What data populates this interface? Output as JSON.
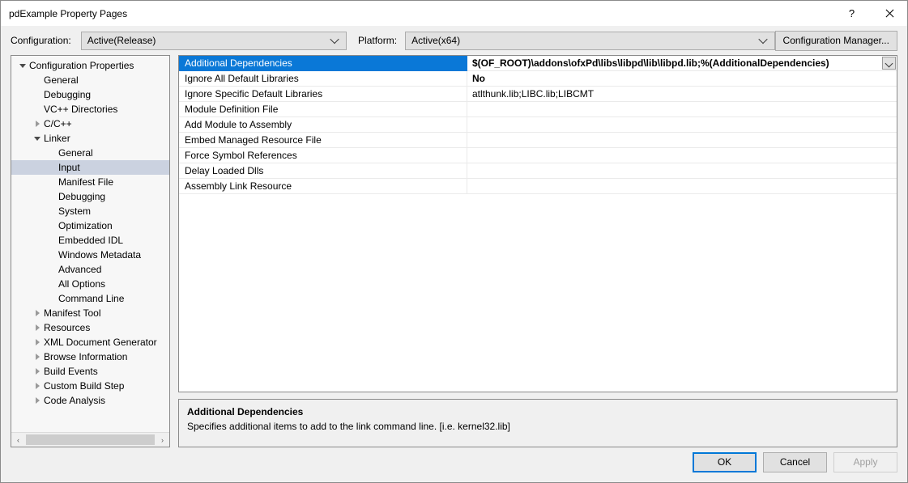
{
  "window": {
    "title": "pdExample Property Pages",
    "help_glyph": "?",
    "close_glyph": "✕"
  },
  "toolbar": {
    "configuration_label": "Configuration:",
    "configuration_value": "Active(Release)",
    "platform_label": "Platform:",
    "platform_value": "Active(x64)",
    "configuration_manager_label": "Configuration Manager..."
  },
  "tree": {
    "nodes": [
      {
        "label": "Configuration Properties",
        "indent": 0,
        "expander": "open",
        "selected": false
      },
      {
        "label": "General",
        "indent": 1,
        "expander": "none",
        "selected": false
      },
      {
        "label": "Debugging",
        "indent": 1,
        "expander": "none",
        "selected": false
      },
      {
        "label": "VC++ Directories",
        "indent": 1,
        "expander": "none",
        "selected": false
      },
      {
        "label": "C/C++",
        "indent": 1,
        "expander": "closed",
        "selected": false
      },
      {
        "label": "Linker",
        "indent": 1,
        "expander": "open",
        "selected": false
      },
      {
        "label": "General",
        "indent": 2,
        "expander": "none",
        "selected": false
      },
      {
        "label": "Input",
        "indent": 2,
        "expander": "none",
        "selected": true
      },
      {
        "label": "Manifest File",
        "indent": 2,
        "expander": "none",
        "selected": false
      },
      {
        "label": "Debugging",
        "indent": 2,
        "expander": "none",
        "selected": false
      },
      {
        "label": "System",
        "indent": 2,
        "expander": "none",
        "selected": false
      },
      {
        "label": "Optimization",
        "indent": 2,
        "expander": "none",
        "selected": false
      },
      {
        "label": "Embedded IDL",
        "indent": 2,
        "expander": "none",
        "selected": false
      },
      {
        "label": "Windows Metadata",
        "indent": 2,
        "expander": "none",
        "selected": false
      },
      {
        "label": "Advanced",
        "indent": 2,
        "expander": "none",
        "selected": false
      },
      {
        "label": "All Options",
        "indent": 2,
        "expander": "none",
        "selected": false
      },
      {
        "label": "Command Line",
        "indent": 2,
        "expander": "none",
        "selected": false
      },
      {
        "label": "Manifest Tool",
        "indent": 1,
        "expander": "closed",
        "selected": false
      },
      {
        "label": "Resources",
        "indent": 1,
        "expander": "closed",
        "selected": false
      },
      {
        "label": "XML Document Generator",
        "indent": 1,
        "expander": "closed",
        "selected": false
      },
      {
        "label": "Browse Information",
        "indent": 1,
        "expander": "closed",
        "selected": false
      },
      {
        "label": "Build Events",
        "indent": 1,
        "expander": "closed",
        "selected": false
      },
      {
        "label": "Custom Build Step",
        "indent": 1,
        "expander": "closed",
        "selected": false
      },
      {
        "label": "Code Analysis",
        "indent": 1,
        "expander": "closed",
        "selected": false
      }
    ],
    "scrollbar": {
      "left_arrow": "‹",
      "right_arrow": "›"
    }
  },
  "grid": {
    "rows": [
      {
        "name": "Additional Dependencies",
        "value": "$(OF_ROOT)\\addons\\ofxPd\\libs\\libpd\\lib\\libpd.lib;%(AdditionalDependencies)",
        "selected": true,
        "bold": true,
        "dropdown": true
      },
      {
        "name": "Ignore All Default Libraries",
        "value": "No",
        "selected": false,
        "bold": true,
        "dropdown": false
      },
      {
        "name": "Ignore Specific Default Libraries",
        "value": "atlthunk.lib;LIBC.lib;LIBCMT",
        "selected": false,
        "bold": false,
        "dropdown": false
      },
      {
        "name": "Module Definition File",
        "value": "",
        "selected": false,
        "bold": false,
        "dropdown": false
      },
      {
        "name": "Add Module to Assembly",
        "value": "",
        "selected": false,
        "bold": false,
        "dropdown": false
      },
      {
        "name": "Embed Managed Resource File",
        "value": "",
        "selected": false,
        "bold": false,
        "dropdown": false
      },
      {
        "name": "Force Symbol References",
        "value": "",
        "selected": false,
        "bold": false,
        "dropdown": false
      },
      {
        "name": "Delay Loaded Dlls",
        "value": "",
        "selected": false,
        "bold": false,
        "dropdown": false
      },
      {
        "name": "Assembly Link Resource",
        "value": "",
        "selected": false,
        "bold": false,
        "dropdown": false
      }
    ]
  },
  "description": {
    "title": "Additional Dependencies",
    "body": "Specifies additional items to add to the link command line. [i.e. kernel32.lib]"
  },
  "footer": {
    "ok_label": "OK",
    "cancel_label": "Cancel",
    "apply_label": "Apply"
  },
  "colors": {
    "selection_blue": "#0a78d7",
    "tree_selection": "#cbd2e0",
    "focus_border": "#0078d7",
    "dialog_bg": "#f0f0f0"
  }
}
